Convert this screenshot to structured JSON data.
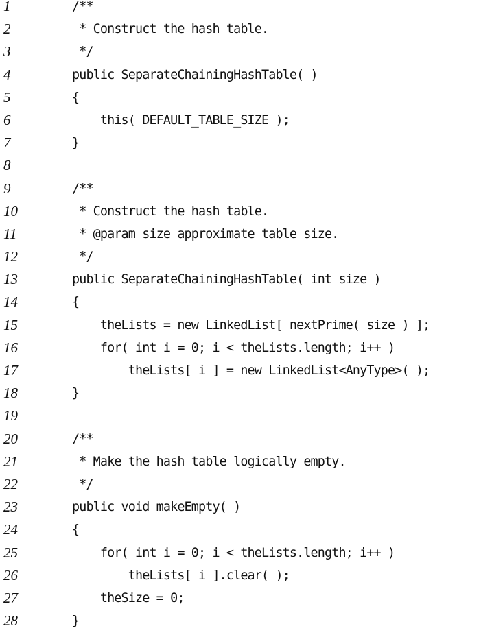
{
  "lines": [
    {
      "num": "1",
      "code": "/**"
    },
    {
      "num": "2",
      "code": " * Construct the hash table."
    },
    {
      "num": "3",
      "code": " */"
    },
    {
      "num": "4",
      "code": "public SeparateChainingHashTable( )"
    },
    {
      "num": "5",
      "code": "{"
    },
    {
      "num": "6",
      "code": "    this( DEFAULT_TABLE_SIZE );"
    },
    {
      "num": "7",
      "code": "}"
    },
    {
      "num": "8",
      "code": ""
    },
    {
      "num": "9",
      "code": "/**"
    },
    {
      "num": "10",
      "code": " * Construct the hash table."
    },
    {
      "num": "11",
      "code": " * @param size approximate table size."
    },
    {
      "num": "12",
      "code": " */"
    },
    {
      "num": "13",
      "code": "public SeparateChainingHashTable( int size )"
    },
    {
      "num": "14",
      "code": "{"
    },
    {
      "num": "15",
      "code": "    theLists = new LinkedList[ nextPrime( size ) ];"
    },
    {
      "num": "16",
      "code": "    for( int i = 0; i < theLists.length; i++ )"
    },
    {
      "num": "17",
      "code": "        theLists[ i ] = new LinkedList<AnyType>( );"
    },
    {
      "num": "18",
      "code": "}"
    },
    {
      "num": "19",
      "code": ""
    },
    {
      "num": "20",
      "code": "/**"
    },
    {
      "num": "21",
      "code": " * Make the hash table logically empty."
    },
    {
      "num": "22",
      "code": " */"
    },
    {
      "num": "23",
      "code": "public void makeEmpty( )"
    },
    {
      "num": "24",
      "code": "{"
    },
    {
      "num": "25",
      "code": "    for( int i = 0; i < theLists.length; i++ )"
    },
    {
      "num": "26",
      "code": "        theLists[ i ].clear( );"
    },
    {
      "num": "27",
      "code": "    theSize = 0;"
    },
    {
      "num": "28",
      "code": "}"
    }
  ]
}
